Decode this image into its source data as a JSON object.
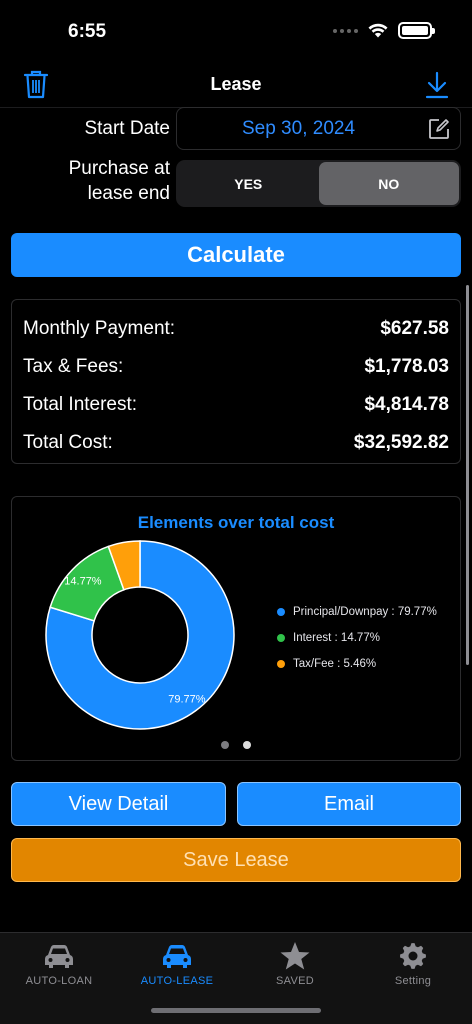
{
  "status": {
    "time": "6:55"
  },
  "nav": {
    "title": "Lease"
  },
  "form": {
    "start_date_label": "Start Date",
    "start_date_value": "Sep 30, 2024",
    "purchase_label_line1": "Purchase at",
    "purchase_label_line2": "lease end",
    "options": [
      "YES",
      "NO"
    ],
    "selected": "NO"
  },
  "calculate_label": "Calculate",
  "results": [
    {
      "label": "Monthly Payment:",
      "value": "$627.58"
    },
    {
      "label": "Tax & Fees:",
      "value": "$1,778.03"
    },
    {
      "label": "Total Interest:",
      "value": "$4,814.78"
    },
    {
      "label": "Total Cost:",
      "value": "$32,592.82"
    }
  ],
  "chart_data": {
    "type": "pie",
    "title": "Elements over total cost",
    "series": [
      {
        "name": "Principal/Downpay",
        "value": 79.77,
        "color": "#1a8cff",
        "slice_label": "79.77%",
        "legend": "Principal/Downpay : 79.77%"
      },
      {
        "name": "Interest",
        "value": 14.77,
        "color": "#30c24a",
        "slice_label": "14.77%",
        "legend": "Interest : 14.77%"
      },
      {
        "name": "Tax/Fee",
        "value": 5.46,
        "color": "#ff9f0a",
        "slice_label": "",
        "legend": "Tax/Fee : 5.46%"
      }
    ],
    "legend_position": "right"
  },
  "actions": {
    "view_detail": "View Detail",
    "email": "Email",
    "save_lease": "Save Lease"
  },
  "tabs": [
    {
      "label": "AUTO-LOAN",
      "icon": "car-icon",
      "active": false
    },
    {
      "label": "AUTO-LEASE",
      "icon": "car-icon",
      "active": true
    },
    {
      "label": "SAVED",
      "icon": "star-icon",
      "active": false
    },
    {
      "label": "Setting",
      "icon": "gear-icon",
      "active": false
    }
  ],
  "colors": {
    "accent": "#1a8cff",
    "save": "#e28600"
  }
}
